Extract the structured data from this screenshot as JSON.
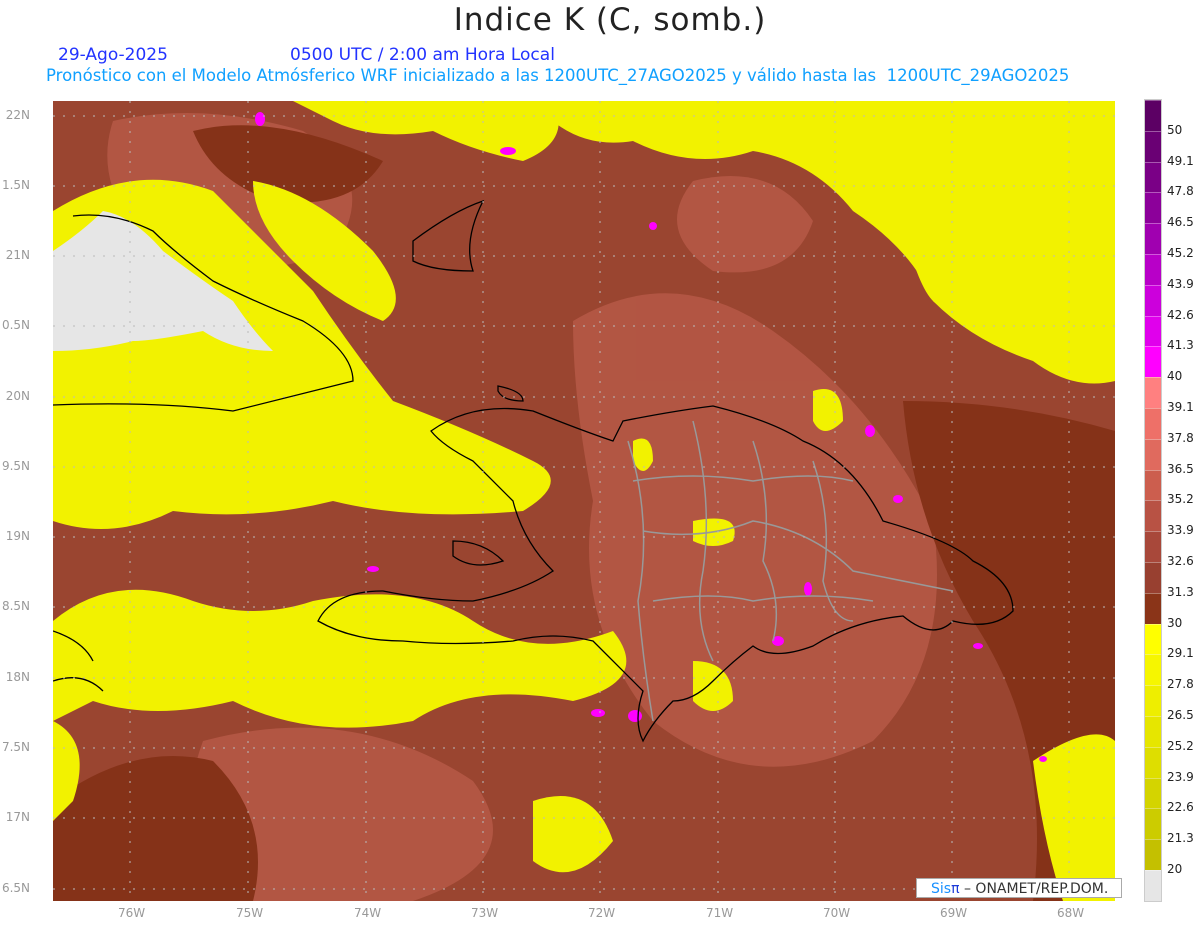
{
  "header": {
    "title": "Indice K (C, somb.)",
    "date": "29-Ago-2025",
    "time": "0500 UTC / 2:00 am Hora Local",
    "subtitle": "Pronóstico con el Modelo Atmósferico WRF inicializado a las 1200UTC_27AGO2025 y válido hasta las  1200UTC_29AGO2025"
  },
  "axes": {
    "lon_labels": [
      "76W",
      "75W",
      "74W",
      "73W",
      "72W",
      "71W",
      "70W",
      "69W",
      "68W"
    ],
    "lat_labels": [
      "22N",
      "1.5N",
      "21N",
      "0.5N",
      "20N",
      "9.5N",
      "19N",
      "8.5N",
      "18N",
      "7.5N",
      "17N",
      "6.5N"
    ]
  },
  "colorbar": {
    "labels": [
      "50",
      "49.1",
      "47.8",
      "46.5",
      "45.2",
      "43.9",
      "42.6",
      "41.3",
      "40",
      "39.1",
      "37.8",
      "36.5",
      "35.2",
      "33.9",
      "32.6",
      "31.3",
      "30",
      "29.1",
      "27.8",
      "26.5",
      "25.2",
      "23.9",
      "22.6",
      "21.3",
      "20"
    ],
    "colors": [
      "#5c0064",
      "#6a0074",
      "#7a0086",
      "#8c009a",
      "#a000b0",
      "#b800c8",
      "#cc00dc",
      "#e000ec",
      "#ff00ff",
      "#ff8080",
      "#ee7068",
      "#e06a5e",
      "#cc5e4e",
      "#b85244",
      "#a8483a",
      "#984030",
      "#8a3418",
      "#ffff00",
      "#f6f600",
      "#eeee00",
      "#e6e600",
      "#dede00",
      "#d4d400",
      "#cccc00",
      "#c4c000",
      "#e6e6e6"
    ]
  },
  "credit": {
    "brand_a": "Sis",
    "brand_b": "π",
    "text": "– ONAMET/REP.DOM."
  }
}
